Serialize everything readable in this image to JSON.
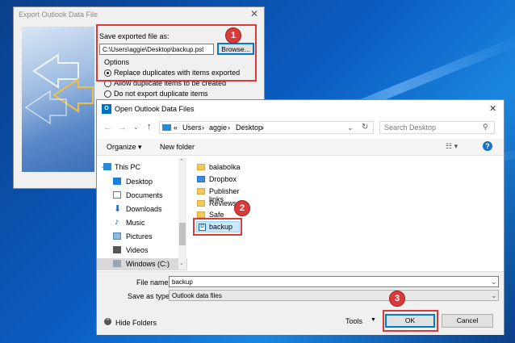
{
  "export_dialog": {
    "title": "Export Outlook Data File",
    "close_label": "✕",
    "save_label": "Save exported file as:",
    "file_path": "C:\\Users\\aggie\\Desktop\\backup.pst",
    "browse_label": "Browse...",
    "options_label": "Options",
    "options": [
      "Replace duplicates with items exported",
      "Allow duplicate items to be created",
      "Do not export duplicate items"
    ]
  },
  "open_dialog": {
    "title": "Open Outlook Data Files",
    "close_label": "✕",
    "breadcrumb": [
      "«",
      "Users",
      "aggie",
      "Desktop"
    ],
    "search_placeholder": "Search Desktop",
    "organize_label": "Organize ▾",
    "new_folder_label": "New folder",
    "help_label": "?",
    "nav_items": [
      "This PC",
      "Desktop",
      "Documents",
      "Downloads",
      "Music",
      "Pictures",
      "Videos",
      "Windows (C:)"
    ],
    "files": [
      "balabolka",
      "Dropbox",
      "Publisher links",
      "Reviews",
      "Safe",
      "backup"
    ],
    "file_name_label": "File name:",
    "file_name_value": "backup",
    "save_type_label": "Save as type:",
    "save_type_value": "Outlook data files",
    "hide_folders_label": "Hide Folders",
    "tools_label": "Tools",
    "ok_label": "OK",
    "cancel_label": "Cancel"
  },
  "badges": [
    "1",
    "2",
    "3"
  ],
  "colors": {
    "highlight": "#d93a3a",
    "accent": "#0078d7",
    "selection": "#cce8ff"
  }
}
